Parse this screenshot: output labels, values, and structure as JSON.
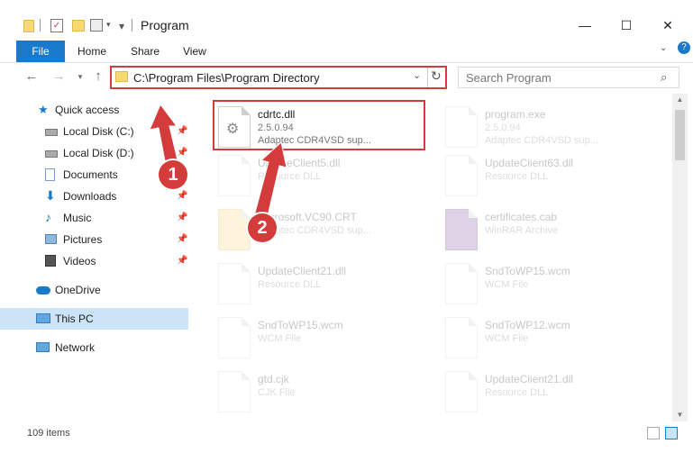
{
  "window": {
    "title": "Program",
    "minimize": "—",
    "maximize": "☐",
    "close": "✕"
  },
  "ribbon": {
    "tabs": [
      "File",
      "Home",
      "Share",
      "View"
    ],
    "help": "?"
  },
  "nav": {
    "address": "C:\\Program Files\\Program Directory",
    "search_placeholder": "Search Program"
  },
  "sidebar": {
    "items": [
      {
        "label": "Quick access",
        "icon": "star-icon"
      },
      {
        "label": "Local Disk (C:)",
        "icon": "drive-icon"
      },
      {
        "label": "Local Disk (D:)",
        "icon": "drive-icon"
      },
      {
        "label": "Documents",
        "icon": "documents-icon"
      },
      {
        "label": "Downloads",
        "icon": "download-icon"
      },
      {
        "label": "Music",
        "icon": "music-icon"
      },
      {
        "label": "Pictures",
        "icon": "pictures-icon"
      },
      {
        "label": "Videos",
        "icon": "videos-icon"
      },
      {
        "label": "OneDrive",
        "icon": "cloud-icon"
      },
      {
        "label": "This PC",
        "icon": "pc-icon"
      },
      {
        "label": "Network",
        "icon": "network-icon"
      }
    ]
  },
  "files": [
    {
      "name": "cdrtc.dll",
      "line2": "2.5.0.94",
      "line3": "Adaptec CDR4VSD sup...",
      "highlighted": true
    },
    {
      "name": "program.exe",
      "line2": "2.5.0.94",
      "line3": "Adaptec CDR4VSD sup..."
    },
    {
      "name": "UpdateClient5.dll",
      "line2": "Resource DLL",
      "line3": ""
    },
    {
      "name": "UpdateClient63.dll",
      "line2": "Resource DLL",
      "line3": ""
    },
    {
      "name": "Microsoft.VC90.CRT",
      "line2": "Adaptec CDR4VSD sup...",
      "line3": ""
    },
    {
      "name": "certificates.cab",
      "line2": "WinRAR Archive",
      "line3": ""
    },
    {
      "name": "UpdateClient21.dll",
      "line2": "Resource DLL",
      "line3": ""
    },
    {
      "name": "SndToWP15.wcm",
      "line2": "WCM File",
      "line3": ""
    },
    {
      "name": "SndToWP15.wcm",
      "line2": "WCM File",
      "line3": ""
    },
    {
      "name": "SndToWP12.wcm",
      "line2": "WCM File",
      "line3": ""
    },
    {
      "name": "gtd.cjk",
      "line2": "CJK File",
      "line3": ""
    },
    {
      "name": "UpdateClient21.dll",
      "line2": "Resource DLL",
      "line3": ""
    }
  ],
  "markers": [
    "1",
    "2"
  ],
  "status": {
    "count": "109 items"
  },
  "colors": {
    "accent": "#1979ca",
    "highlight": "#d43c3c",
    "selected": "#cce4f7"
  }
}
